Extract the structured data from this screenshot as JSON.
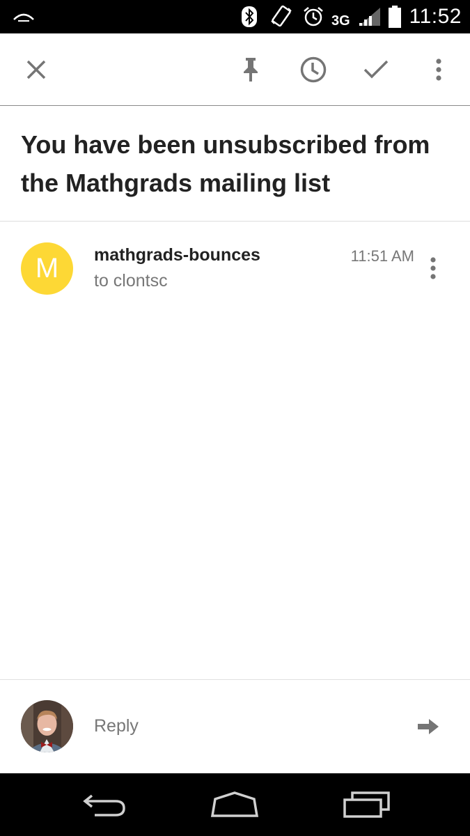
{
  "status_bar": {
    "time": "11:52",
    "network": "3G",
    "icons": [
      "notification-icon",
      "bluetooth-icon",
      "vibrate-icon",
      "alarm-icon",
      "signal-icon",
      "battery-icon"
    ]
  },
  "toolbar": {
    "actions": [
      "close-icon",
      "pin-icon",
      "snooze-icon",
      "done-icon",
      "more-icon"
    ]
  },
  "email": {
    "subject": "You have been unsubscribed from the Mathgrads mailing list",
    "sender": "mathgrads-bounces",
    "sender_initial": "M",
    "recipient": "to clontsc",
    "time": "11:51 AM",
    "avatar_color": "#fdd835"
  },
  "reply": {
    "placeholder": "Reply"
  },
  "nav_bar": {
    "buttons": [
      "back-icon",
      "home-icon",
      "recents-icon"
    ]
  }
}
